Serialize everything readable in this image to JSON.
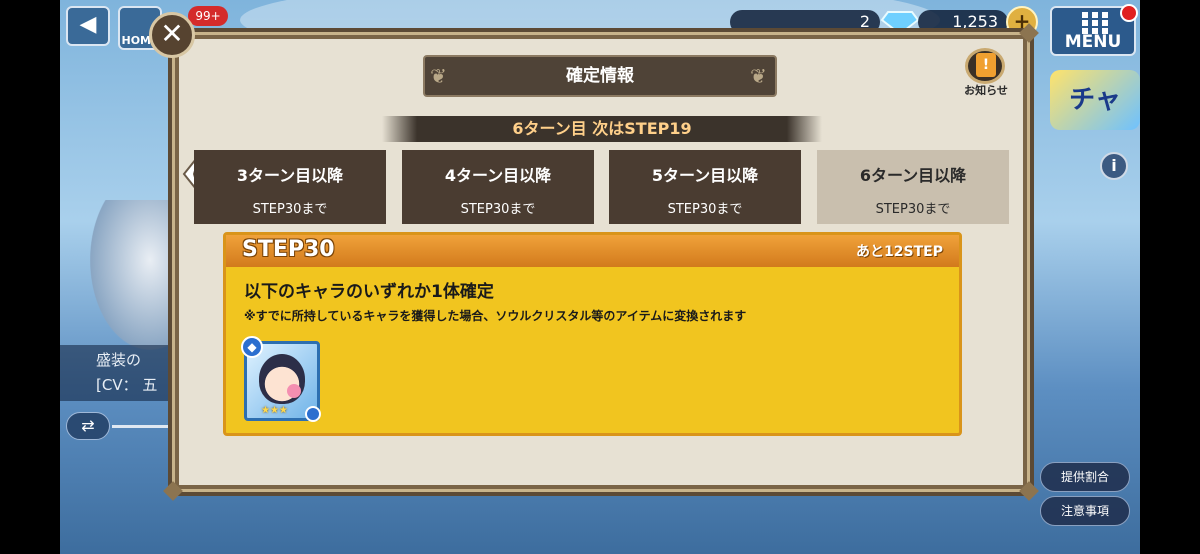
{
  "background": {
    "char_name": "盛装の",
    "cv_label": "[CV： 五",
    "side_buttons": [
      "提供割合",
      "注意事項"
    ],
    "gacha_badge": "チャ"
  },
  "topbar": {
    "back_icon": "back-arrow-icon",
    "home_label": "HOME",
    "badge": "99+",
    "counter1": "2",
    "counter2": "1,253",
    "plus": "+",
    "menu_label": "MENU"
  },
  "modal": {
    "close_symbol": "✕",
    "title": "確定情報",
    "notice_label": "お知らせ",
    "notice_glyph": "!",
    "turn_banner": "6ターン目 次はSTEP19",
    "tabs": [
      {
        "title": "3ターン目以降",
        "sub": "STEP30まで"
      },
      {
        "title": "4ターン目以降",
        "sub": "STEP30まで"
      },
      {
        "title": "5ターン目以降",
        "sub": "STEP30まで"
      },
      {
        "title": "6ターン目以降",
        "sub": "STEP30まで"
      }
    ],
    "step": {
      "name": "STEP30",
      "remaining": "あと12STEP",
      "title": "以下のキャラのいずれか1体確定",
      "note": "※すでに所持しているキャラを獲得した場合、ソウルクリスタル等のアイテムに変換されます",
      "stars": "★★★",
      "attr_glyph": "◆"
    }
  },
  "colors": {
    "modal_bg": "#e7e1d3",
    "tab_dark": "#4a3c31",
    "tab_active": "#c9bfae",
    "step_yellow": "#f1c51f",
    "step_head": "#d27a1c"
  }
}
